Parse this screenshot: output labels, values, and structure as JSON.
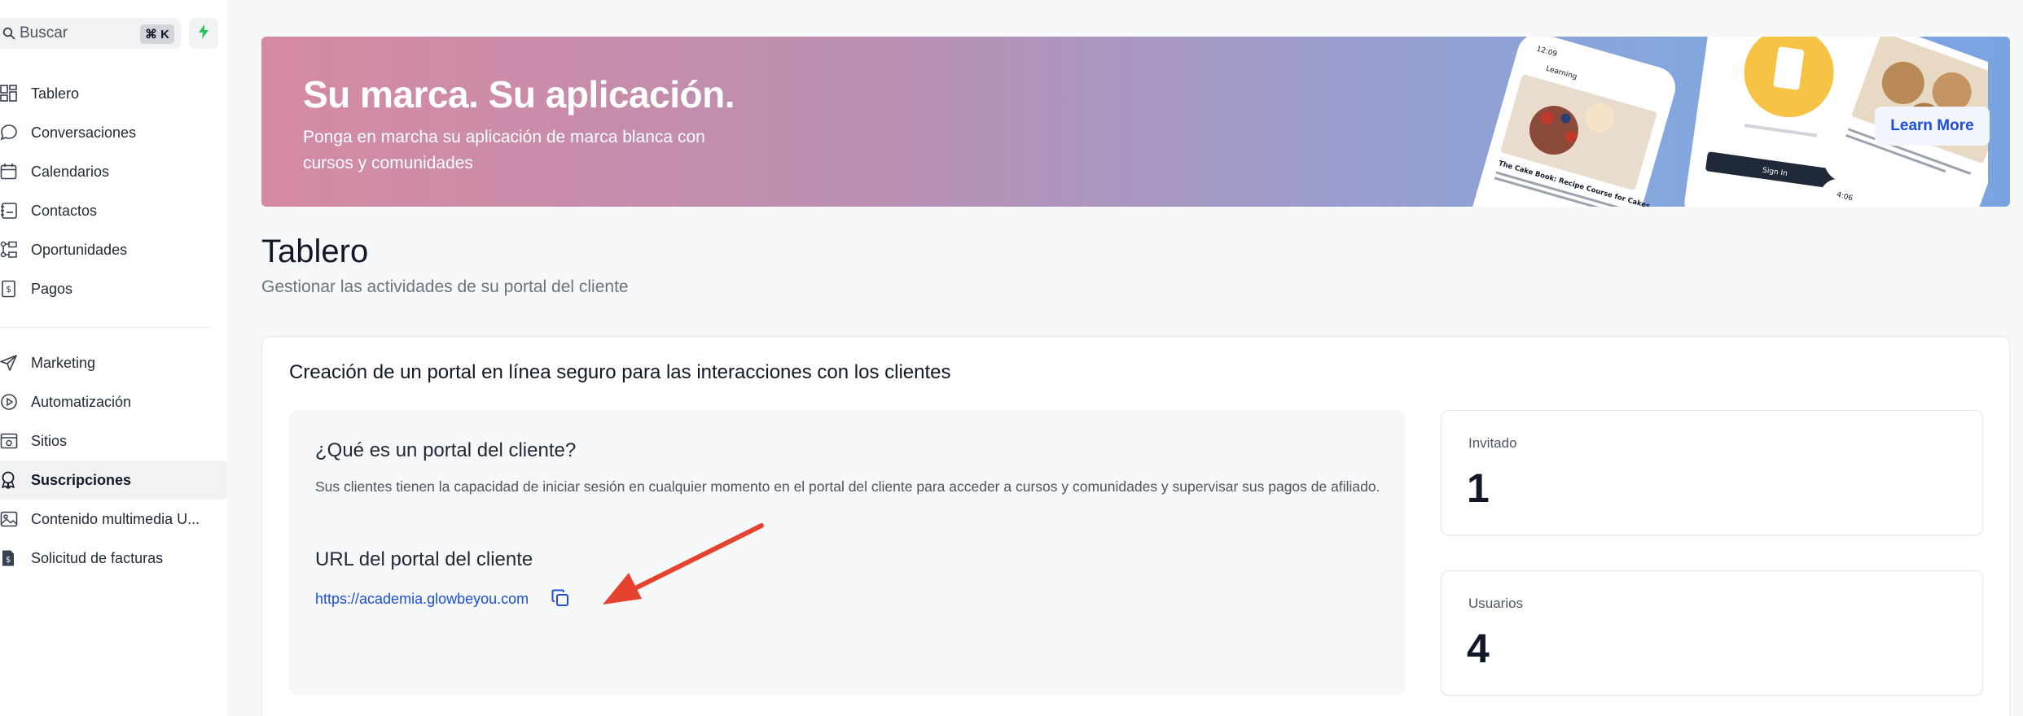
{
  "sidebar": {
    "search_placeholder": "Buscar",
    "search_shortcut": "⌘ K",
    "primary_items": [
      {
        "label": "Tablero",
        "icon": "grid-icon"
      },
      {
        "label": "Conversaciones",
        "icon": "chat-icon"
      },
      {
        "label": "Calendarios",
        "icon": "calendar-icon"
      },
      {
        "label": "Contactos",
        "icon": "contacts-icon"
      },
      {
        "label": "Oportunidades",
        "icon": "opportunities-icon"
      },
      {
        "label": "Pagos",
        "icon": "payments-icon"
      }
    ],
    "secondary_items": [
      {
        "label": "Marketing",
        "icon": "send-icon"
      },
      {
        "label": "Automatización",
        "icon": "automation-icon"
      },
      {
        "label": "Sitios",
        "icon": "sites-icon"
      },
      {
        "label": "Suscripciones",
        "icon": "award-icon",
        "active": true
      },
      {
        "label": "Contenido multimedia U...",
        "icon": "image-icon"
      },
      {
        "label": "Solicitud de facturas",
        "icon": "invoice-icon"
      }
    ]
  },
  "banner": {
    "title": "Su marca. Su aplicación.",
    "subtitle": "Ponga en marcha su aplicación de marca blanca con cursos y comunidades",
    "button": "Learn More",
    "phone_texts": {
      "time1": "12:09",
      "app": "Learning",
      "course": "The Cake Book: Recipe Course for Cakes",
      "signin": "Sign In",
      "time2": "4:06"
    }
  },
  "page": {
    "title": "Tablero",
    "subtitle": "Gestionar las actividades de su portal del cliente"
  },
  "card": {
    "heading": "Creación de un portal en línea seguro para las interacciones con los clientes",
    "question": "¿Qué es un portal del cliente?",
    "description": "Sus clientes tienen la capacidad de iniciar sesión en cualquier momento en el portal del cliente para acceder a cursos y comunidades y supervisar sus pagos de afiliado.",
    "url_heading": "URL del portal del cliente",
    "url": "https://academia.glowbeyou.com"
  },
  "stats": [
    {
      "label": "Invitado",
      "value": "1"
    },
    {
      "label": "Usuarios",
      "value": "4"
    }
  ],
  "colors": {
    "accent": "#1d4ed8",
    "annotation_arrow": "#e5432f",
    "bolt": "#22c55e"
  }
}
